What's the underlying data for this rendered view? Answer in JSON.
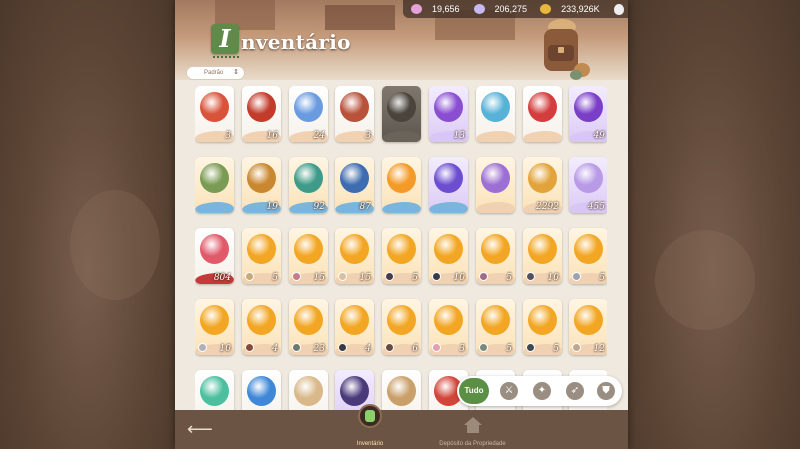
{
  "screen": {
    "title_initial": "I",
    "title_rest": "nventário"
  },
  "topbar": {
    "resources": [
      {
        "icon": "pink-crystal-icon",
        "value": "19,656",
        "color": "#e6a2d8"
      },
      {
        "icon": "purple-gem-icon",
        "value": "206,275",
        "color": "#c8b9f2"
      },
      {
        "icon": "gold-coin-icon",
        "value": "233,926K",
        "color": "#e8b83c"
      }
    ],
    "bag_icon": "money-bag-icon"
  },
  "sort": {
    "selected": "Padrão"
  },
  "items": [
    {
      "icon": "ticket-icon",
      "qty": "3",
      "rarity": "white",
      "accent": "#d9533a",
      "wave": "#f0d2b3"
    },
    {
      "icon": "red-ribbon-box-icon",
      "qty": "16",
      "rarity": "white",
      "accent": "#c23b2b",
      "wave": "#f0d2b3"
    },
    {
      "icon": "crystal-orb-icon",
      "qty": "24",
      "rarity": "white",
      "accent": "#6a9be0",
      "wave": "#f0d2b3"
    },
    {
      "icon": "treasure-chest-icon",
      "qty": "3",
      "rarity": "white",
      "accent": "#b9523b",
      "wave": "#f0d2b3"
    },
    {
      "icon": "lock-icon",
      "qty": "",
      "rarity": "locked",
      "accent": "#4a443d",
      "wave": "#6a635a"
    },
    {
      "icon": "purple-eye-orb-icon",
      "qty": "13",
      "rarity": "purple",
      "accent": "#8a4ed1",
      "wave": "#d8c7f5"
    },
    {
      "icon": "potion-bottle-icon",
      "qty": "",
      "rarity": "white",
      "accent": "#58b2d8",
      "wave": "#f0d2b3"
    },
    {
      "icon": "red-potion-icon",
      "qty": "",
      "rarity": "white",
      "accent": "#d33d3d",
      "wave": "#f0d2b3"
    },
    {
      "icon": "purple-crown-orb-icon",
      "qty": "49",
      "rarity": "purple",
      "accent": "#7a3fc7",
      "wave": "#d8c7f5"
    },
    {
      "icon": "green-acorn-icon",
      "qty": "",
      "rarity": "gold",
      "accent": "#7a9b54",
      "wave": "#7ab5dc"
    },
    {
      "icon": "orange-acorn-icon",
      "qty": "19",
      "rarity": "gold",
      "accent": "#c9872f",
      "wave": "#7ab5dc"
    },
    {
      "icon": "teal-acorn-icon",
      "qty": "92",
      "rarity": "gold",
      "accent": "#3e9b8a",
      "wave": "#7ab5dc"
    },
    {
      "icon": "blue-acorn-icon",
      "qty": "87",
      "rarity": "gold",
      "accent": "#3d6cb0",
      "wave": "#7ab5dc"
    },
    {
      "icon": "orange-card-icon",
      "qty": "",
      "rarity": "gold",
      "accent": "#f39a28",
      "wave": "#7ab5dc"
    },
    {
      "icon": "purple-card-icon",
      "qty": "",
      "rarity": "purple",
      "accent": "#6d4ed0",
      "wave": "#7ab5dc"
    },
    {
      "icon": "purple-chest-icon",
      "qty": "",
      "rarity": "gold",
      "accent": "#9b6fd3",
      "wave": "#f0d2b3"
    },
    {
      "icon": "golden-acorn-icon",
      "qty": "2292",
      "rarity": "gold",
      "accent": "#e2a33a",
      "wave": "#f0d2b3"
    },
    {
      "icon": "rainbow-crystal-icon",
      "qty": "455",
      "rarity": "purple",
      "accent": "#b89ae6",
      "wave": "#d8c7f5"
    },
    {
      "icon": "red-crystal-icon",
      "qty": "804",
      "rarity": "white",
      "accent": "#e05a6a",
      "wave": "#c43a3a"
    },
    {
      "icon": "gold-shard-icon",
      "qty": "5",
      "rarity": "gold",
      "accent": "#f2a623",
      "wave": "#f0d2b3",
      "avatar": "#c9a87a"
    },
    {
      "icon": "gold-shard-icon",
      "qty": "15",
      "rarity": "gold",
      "accent": "#f2a623",
      "wave": "#f0d2b3",
      "avatar": "#c87a8a"
    },
    {
      "icon": "gold-shard-icon",
      "qty": "15",
      "rarity": "gold",
      "accent": "#f2a623",
      "wave": "#f0d2b3",
      "avatar": "#d8c0a0"
    },
    {
      "icon": "gold-shard-icon",
      "qty": "5",
      "rarity": "gold",
      "accent": "#f2a623",
      "wave": "#f0d2b3",
      "avatar": "#4a3a50"
    },
    {
      "icon": "gold-shard-icon",
      "qty": "10",
      "rarity": "gold",
      "accent": "#f2a623",
      "wave": "#f0d2b3",
      "avatar": "#3a3a4a"
    },
    {
      "icon": "gold-shard-icon",
      "qty": "5",
      "rarity": "gold",
      "accent": "#f2a623",
      "wave": "#f0d2b3",
      "avatar": "#a06a8a"
    },
    {
      "icon": "gold-shard-icon",
      "qty": "10",
      "rarity": "gold",
      "accent": "#f2a623",
      "wave": "#f0d2b3",
      "avatar": "#555060"
    },
    {
      "icon": "gold-shard-icon",
      "qty": "5",
      "rarity": "gold",
      "accent": "#f2a623",
      "wave": "#f0d2b3",
      "avatar": "#a0a0b0"
    },
    {
      "icon": "gold-shard-icon",
      "qty": "10",
      "rarity": "gold",
      "accent": "#f2a623",
      "wave": "#f0d2b3",
      "avatar": "#b0b0b8"
    },
    {
      "icon": "gold-shard-icon",
      "qty": "4",
      "rarity": "gold",
      "accent": "#f2a623",
      "wave": "#f0d2b3",
      "avatar": "#8a4a3a"
    },
    {
      "icon": "gold-shard-icon",
      "qty": "23",
      "rarity": "gold",
      "accent": "#f2a623",
      "wave": "#f0d2b3",
      "avatar": "#6a7a70"
    },
    {
      "icon": "gold-shard-icon",
      "qty": "4",
      "rarity": "gold",
      "accent": "#f2a623",
      "wave": "#f0d2b3",
      "avatar": "#3a3a40"
    },
    {
      "icon": "gold-shard-icon",
      "qty": "6",
      "rarity": "gold",
      "accent": "#f2a623",
      "wave": "#f0d2b3",
      "avatar": "#6a4a40"
    },
    {
      "icon": "gold-shard-icon",
      "qty": "3",
      "rarity": "gold",
      "accent": "#f2a623",
      "wave": "#f0d2b3",
      "avatar": "#e0a0b0"
    },
    {
      "icon": "gold-shard-icon",
      "qty": "5",
      "rarity": "gold",
      "accent": "#f2a623",
      "wave": "#f0d2b3",
      "avatar": "#7a8a7a"
    },
    {
      "icon": "gold-shard-icon",
      "qty": "5",
      "rarity": "gold",
      "accent": "#f2a623",
      "wave": "#f0d2b3",
      "avatar": "#404850"
    },
    {
      "icon": "gold-shard-icon",
      "qty": "12",
      "rarity": "gold",
      "accent": "#f2a623",
      "wave": "#f0d2b3",
      "avatar": "#c0a890"
    },
    {
      "icon": "teal-crystal-icon",
      "qty": "",
      "rarity": "white",
      "accent": "#4bbf9e",
      "wave": "#f0d2b3"
    },
    {
      "icon": "blue-crystal-icon",
      "qty": "",
      "rarity": "white",
      "accent": "#3f88d8",
      "wave": "#f0d2b3"
    },
    {
      "icon": "cookie-bear-icon",
      "qty": "",
      "rarity": "white",
      "accent": "#d9b98a",
      "wave": "#f0d2b3"
    },
    {
      "icon": "witch-hat-icon",
      "qty": "",
      "rarity": "purple",
      "accent": "#4a3a7a",
      "wave": "#d8c7f5"
    },
    {
      "icon": "chibi-figure-icon",
      "qty": "",
      "rarity": "white",
      "accent": "#c9a06a",
      "wave": "#f0d2b3"
    },
    {
      "icon": "red-gift-icon",
      "qty": "",
      "rarity": "white",
      "accent": "#d2453a",
      "wave": "#f0d2b3"
    },
    {
      "icon": "item-icon",
      "qty": "",
      "rarity": "white",
      "accent": "#d0c0a8",
      "wave": "#f0d2b3"
    },
    {
      "icon": "item-icon",
      "qty": "",
      "rarity": "white",
      "accent": "#d0c0a8",
      "wave": "#f0d2b3"
    },
    {
      "icon": "item-icon",
      "qty": "",
      "rarity": "white",
      "accent": "#d0c0a8",
      "wave": "#f0d2b3"
    }
  ],
  "filters": {
    "all_label": "Tudo",
    "icons": [
      "sword-filter-icon",
      "star-filter-icon",
      "compass-filter-icon",
      "shield-filter-icon"
    ]
  },
  "bottom_nav": {
    "back_icon": "back-arrow-icon",
    "tabs": [
      {
        "label": "Inventário",
        "icon": "backpack-tab-icon",
        "active": true
      },
      {
        "label": "Depósito da Propriedade",
        "icon": "house-tab-icon",
        "active": false
      }
    ]
  }
}
